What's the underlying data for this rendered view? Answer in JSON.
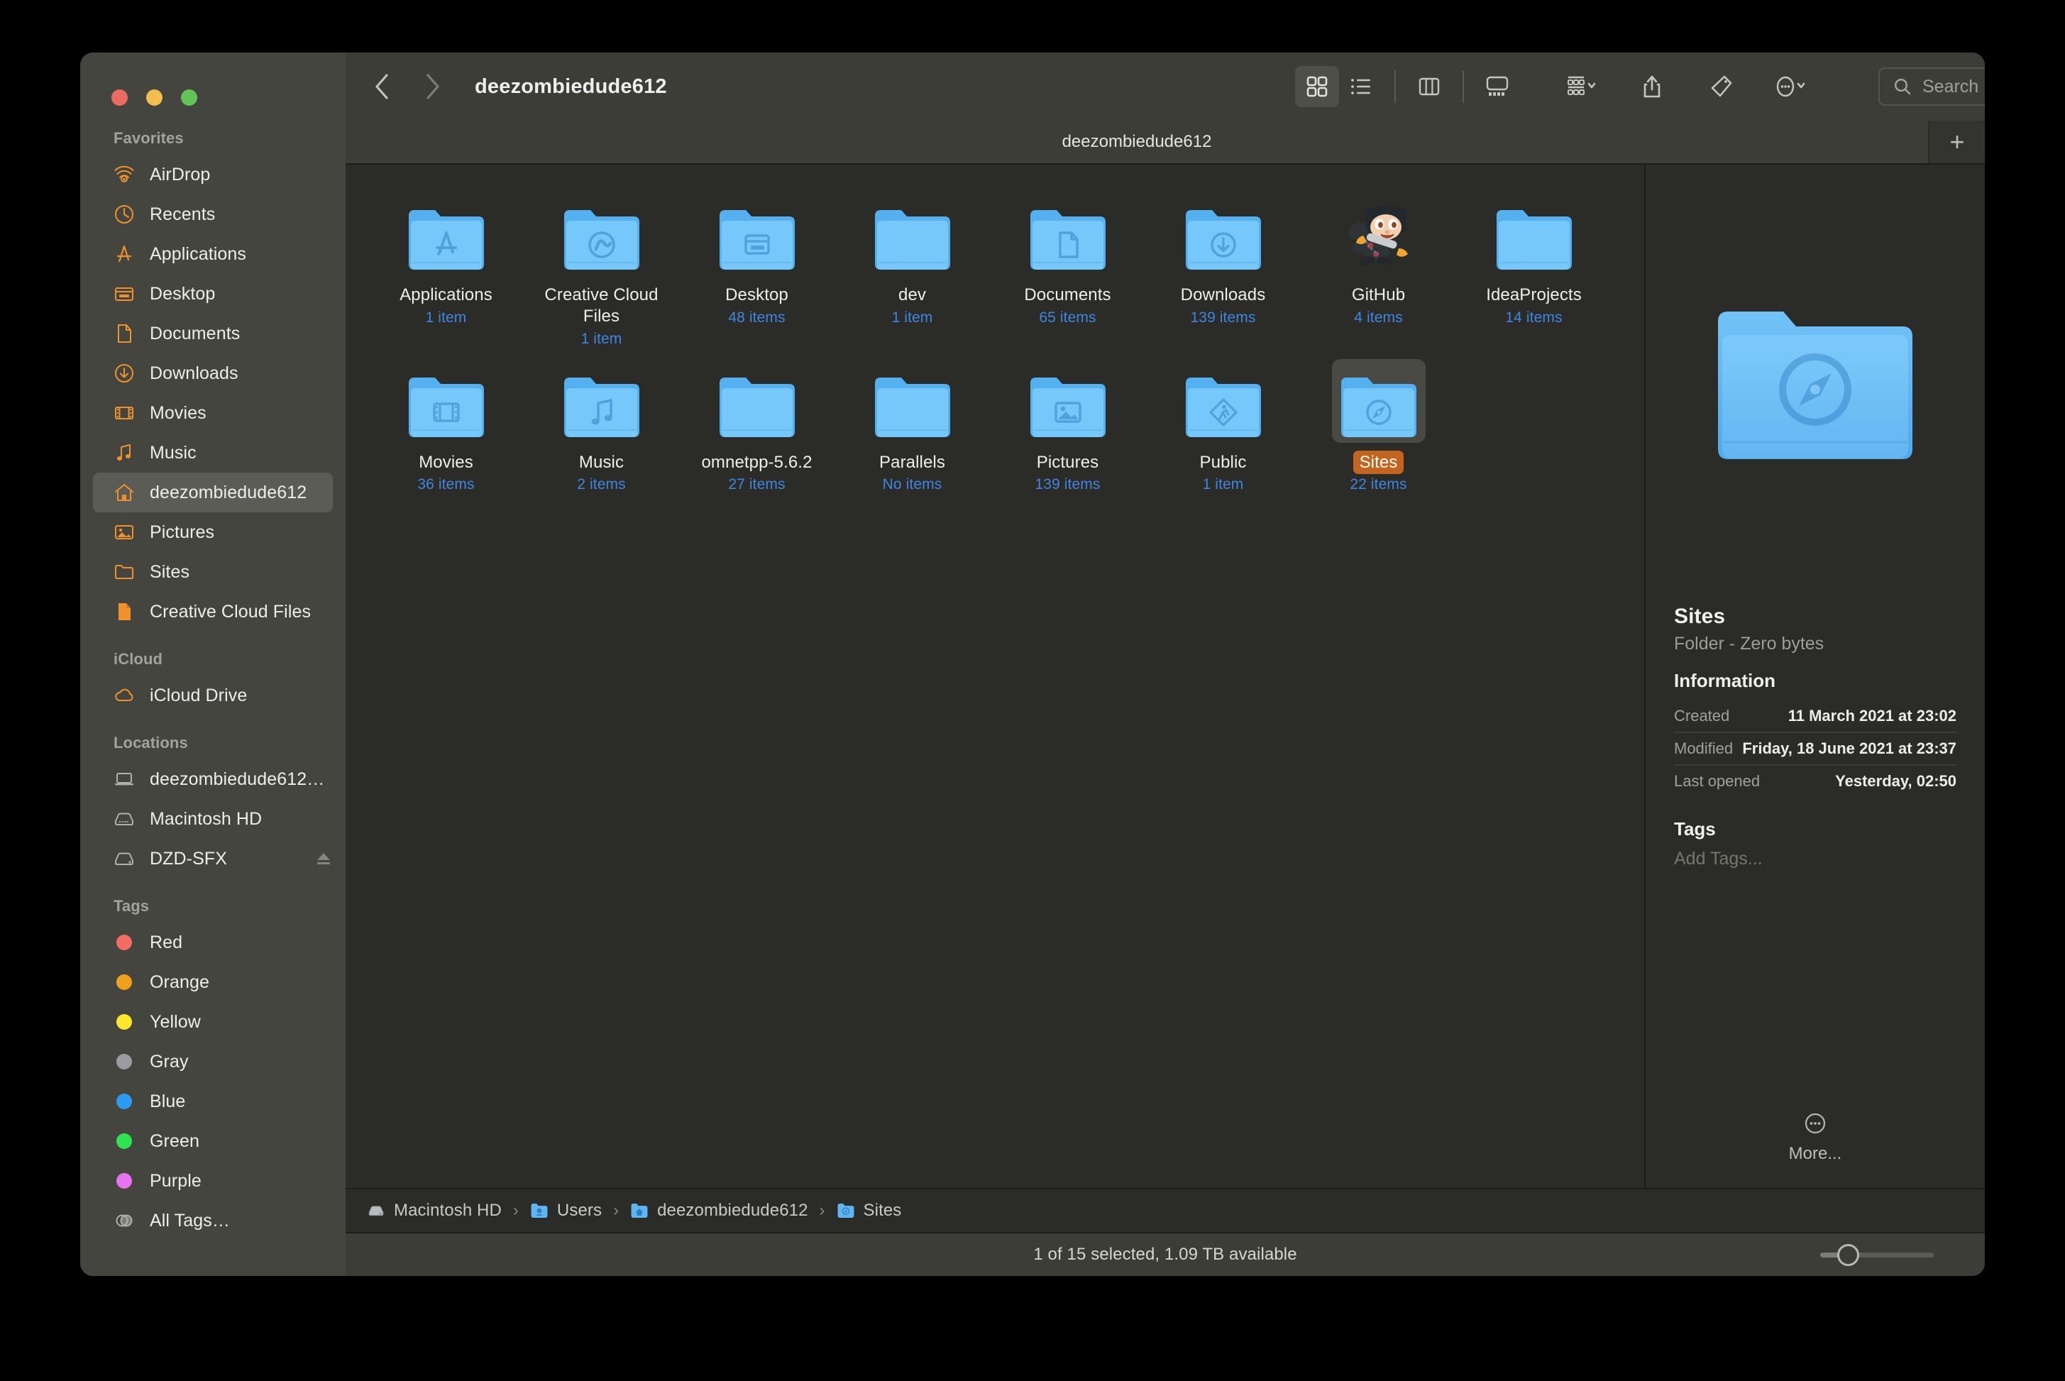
{
  "window": {
    "title": "deezombiedude612",
    "traffic_lights": [
      "close",
      "minimize",
      "zoom"
    ]
  },
  "toolbar": {
    "back_icon": "chevron-left-icon",
    "forward_icon": "chevron-right-icon",
    "folder_title": "deezombiedude612",
    "view_icon_grid": "grid-view-icon",
    "view_icon_list": "list-view-icon",
    "view_icon_column": "column-view-icon",
    "view_icon_gallery": "gallery-view-icon",
    "group_icon": "group-by-icon",
    "share_icon": "share-icon",
    "tag_icon": "tag-icon",
    "more_icon": "more-actions-icon"
  },
  "search": {
    "placeholder": "Search",
    "icon": "search-icon",
    "value": ""
  },
  "tabbar": {
    "active_tab": "deezombiedude612",
    "add_label": "+"
  },
  "sidebar": {
    "sections": [
      {
        "title": "Favorites",
        "items": [
          {
            "label": "AirDrop",
            "icon": "airdrop-icon",
            "selected": false
          },
          {
            "label": "Recents",
            "icon": "clock-icon",
            "selected": false
          },
          {
            "label": "Applications",
            "icon": "app-store-icon",
            "selected": false
          },
          {
            "label": "Desktop",
            "icon": "desktop-icon",
            "selected": false
          },
          {
            "label": "Documents",
            "icon": "document-icon",
            "selected": false
          },
          {
            "label": "Downloads",
            "icon": "download-icon",
            "selected": false
          },
          {
            "label": "Movies",
            "icon": "film-icon",
            "selected": false
          },
          {
            "label": "Music",
            "icon": "music-note-icon",
            "selected": false
          },
          {
            "label": "deezombiedude612",
            "icon": "home-icon",
            "selected": true
          },
          {
            "label": "Pictures",
            "icon": "photo-icon",
            "selected": false
          },
          {
            "label": "Sites",
            "icon": "folder-icon",
            "selected": false
          },
          {
            "label": "Creative Cloud Files",
            "icon": "creative-cloud-file-icon",
            "selected": false
          }
        ]
      },
      {
        "title": "iCloud",
        "items": [
          {
            "label": "iCloud Drive",
            "icon": "cloud-icon",
            "selected": false
          }
        ]
      },
      {
        "title": "Locations",
        "items": [
          {
            "label": "deezombiedude612…",
            "icon": "laptop-icon",
            "selected": false
          },
          {
            "label": "Macintosh HD",
            "icon": "hard-drive-icon",
            "selected": false
          },
          {
            "label": "DZD-SFX",
            "icon": "external-drive-icon",
            "selected": false,
            "eject": true
          }
        ]
      },
      {
        "title": "Tags",
        "items": [
          {
            "label": "Red",
            "icon": "tag-dot-icon",
            "color": "#f26d63",
            "selected": false
          },
          {
            "label": "Orange",
            "icon": "tag-dot-icon",
            "color": "#f0a01b",
            "selected": false
          },
          {
            "label": "Yellow",
            "icon": "tag-dot-icon",
            "color": "#fbe72c",
            "selected": false
          },
          {
            "label": "Gray",
            "icon": "tag-dot-icon",
            "color": "#9b9ba1",
            "selected": false
          },
          {
            "label": "Blue",
            "icon": "tag-dot-icon",
            "color": "#2d9bf0",
            "selected": false
          },
          {
            "label": "Green",
            "icon": "tag-dot-icon",
            "color": "#2fe44e",
            "selected": false
          },
          {
            "label": "Purple",
            "icon": "tag-dot-icon",
            "color": "#e873ef",
            "selected": false
          },
          {
            "label": "All Tags…",
            "icon": "all-tags-icon",
            "selected": false
          }
        ]
      }
    ]
  },
  "files": [
    {
      "name": "Applications",
      "count": "1 item",
      "icon": "folder-applications",
      "selected": false
    },
    {
      "name": "Creative Cloud Files",
      "count": "1 item",
      "icon": "folder-creative-cloud",
      "selected": false
    },
    {
      "name": "Desktop",
      "count": "48 items",
      "icon": "folder-desktop",
      "selected": false
    },
    {
      "name": "dev",
      "count": "1 item",
      "icon": "folder-plain",
      "selected": false
    },
    {
      "name": "Documents",
      "count": "65 items",
      "icon": "folder-documents",
      "selected": false
    },
    {
      "name": "Downloads",
      "count": "139 items",
      "icon": "folder-downloads",
      "selected": false
    },
    {
      "name": "GitHub",
      "count": "4 items",
      "icon": "octocat-icon",
      "selected": false
    },
    {
      "name": "IdeaProjects",
      "count": "14 items",
      "icon": "folder-plain",
      "selected": false
    },
    {
      "name": "Movies",
      "count": "36 items",
      "icon": "folder-movies",
      "selected": false
    },
    {
      "name": "Music",
      "count": "2 items",
      "icon": "folder-music",
      "selected": false
    },
    {
      "name": "omnetpp-5.6.2",
      "count": "27 items",
      "icon": "folder-plain",
      "selected": false
    },
    {
      "name": "Parallels",
      "count": "No items",
      "icon": "folder-plain",
      "selected": false
    },
    {
      "name": "Pictures",
      "count": "139 items",
      "icon": "folder-pictures",
      "selected": false
    },
    {
      "name": "Public",
      "count": "1 item",
      "icon": "folder-public",
      "selected": false
    },
    {
      "name": "Sites",
      "count": "22 items",
      "icon": "folder-sites",
      "selected": true
    }
  ],
  "inspector": {
    "preview_icon": "folder-sites-large",
    "title": "Sites",
    "subtitle": "Folder - Zero bytes",
    "information_heading": "Information",
    "rows": [
      {
        "key": "Created",
        "value": "11 March 2021 at 23:02"
      },
      {
        "key": "Modified",
        "value": "Friday, 18 June 2021 at 23:37"
      },
      {
        "key": "Last opened",
        "value": "Yesterday, 02:50"
      }
    ],
    "tags_heading": "Tags",
    "add_tags": "Add Tags...",
    "more_label": "More...",
    "more_icon": "more-circle-icon"
  },
  "pathbar": {
    "crumbs": [
      {
        "label": "Macintosh HD",
        "icon": "hard-drive-icon"
      },
      {
        "label": "Users",
        "icon": "folder-users-icon"
      },
      {
        "label": "deezombiedude612",
        "icon": "folder-home-icon"
      },
      {
        "label": "Sites",
        "icon": "folder-sites-icon"
      }
    ],
    "separator": "›"
  },
  "statusbar": {
    "text": "1 of 15 selected, 1.09 TB available",
    "zoom_value": 20
  },
  "colors": {
    "accent_orange": "#f0922b",
    "selection_orange": "#c4651f",
    "link_blue": "#3f86e3",
    "folder_blue": "#62b8f6",
    "sidebar_bg": "#45453f",
    "content_bg": "#2b2b28",
    "toolbar_bg": "#3d3d38"
  }
}
